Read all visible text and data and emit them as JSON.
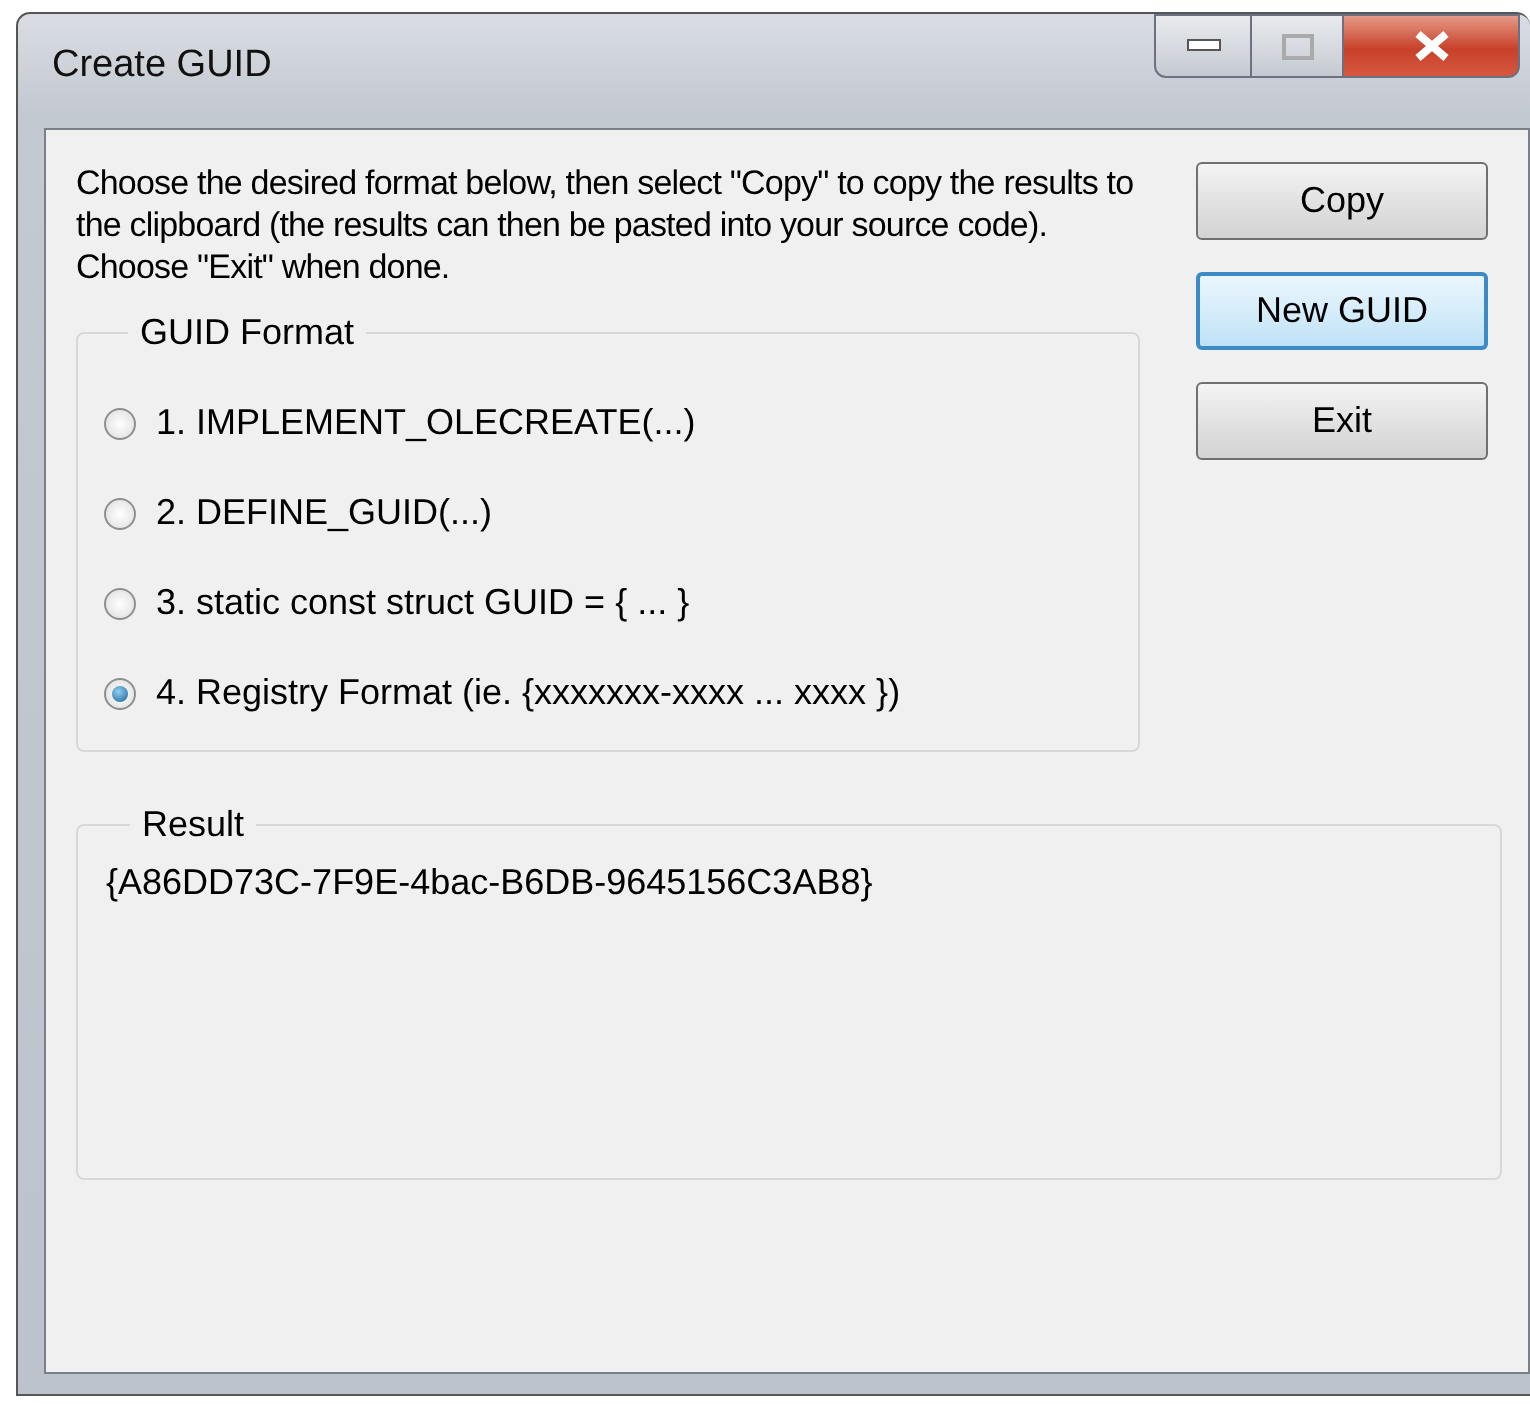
{
  "window": {
    "title": "Create GUID"
  },
  "instructions": "Choose the desired format below, then select \"Copy\" to copy the results to the clipboard (the results can then be pasted into your source code).  Choose \"Exit\" when done.",
  "buttons": [
    {
      "label": "Copy",
      "default": false
    },
    {
      "label": "New GUID",
      "default": true
    },
    {
      "label": "Exit",
      "default": false
    }
  ],
  "guid_format": {
    "title": "GUID Format",
    "options": [
      {
        "label": "1. IMPLEMENT_OLECREATE(...)",
        "selected": false
      },
      {
        "label": "2. DEFINE_GUID(...)",
        "selected": false
      },
      {
        "label": "3. static const struct GUID = { ... }",
        "selected": false
      },
      {
        "label": "4. Registry Format (ie. {xxxxxxx-xxxx ... xxxx })",
        "selected": true
      }
    ]
  },
  "result": {
    "title": "Result",
    "value": "{A86DD73C-7F9E-4bac-B6DB-9645156C3AB8}"
  }
}
